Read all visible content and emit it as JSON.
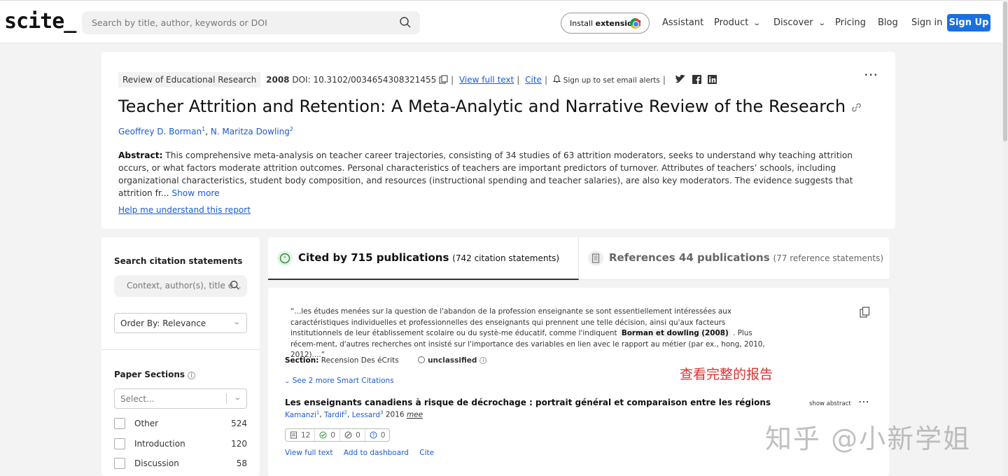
{
  "header": {
    "logo": "scite_",
    "search_placeholder": "Search by title, author, keywords or DOI",
    "extension_prefix": "Install ",
    "extension_bold": "extension!",
    "nav": [
      {
        "label": "Assistant",
        "dropdown": false
      },
      {
        "label": "Product",
        "dropdown": true
      },
      {
        "label": "Discover",
        "dropdown": true
      },
      {
        "label": "Pricing",
        "dropdown": false
      },
      {
        "label": "Blog",
        "dropdown": false
      },
      {
        "label": "Sign in",
        "dropdown": false
      }
    ],
    "signup": "Sign Up"
  },
  "paper": {
    "journal": "Review of Educational Research",
    "year": "2008",
    "doi": "DOI: 10.3102/0034654308321455",
    "view_full_text": "View full text",
    "cite": "Cite",
    "alerts": "Sign up to set email alerts",
    "title": "Teacher Attrition and Retention: A Meta-Analytic and Narrative Review of the Research",
    "authors": [
      {
        "name": "Geoffrey D. Borman",
        "sup": "1"
      },
      {
        "name": "N. Maritza Dowling",
        "sup": "2"
      }
    ],
    "abstract_label": "Abstract:",
    "abstract_text": "This comprehensive meta-analysis on teacher career trajectories, consisting of 34 studies of 63 attrition moderators, seeks to understand why teaching attrition occurs, or what factors moderate attrition outcomes. Personal characteristics of teachers are important predictors of turnover. Attributes of teachers’ schools, including organizational characteristics, student body composition, and resources (instructional spending and teacher salaries), are also key moderators. The evidence suggests that attrition fr...",
    "show_more": "Show more",
    "help_link": "Help me understand this report"
  },
  "sidebar": {
    "search_title": "Search citation statements",
    "search_placeholder": "Context, author(s), title e...",
    "order_by": "Order By: Relevance",
    "sections_title": "Paper Sections",
    "sections_placeholder": "Select...",
    "sections": [
      {
        "label": "Other",
        "count": "524"
      },
      {
        "label": "Introduction",
        "count": "120"
      },
      {
        "label": "Discussion",
        "count": "58"
      }
    ]
  },
  "tabs": {
    "cited_bold": "Cited by 715 publications",
    "cited_small": "(742 citation statements)",
    "refs_bold": "References 44 publications",
    "refs_small": "(77 reference statements)"
  },
  "result": {
    "quote_pre": "“...les études menées sur la question de l'abandon de la profession enseignante se sont essentiellement intéressées aux caractéristiques individuelles et professionnelles des enseignants qui prennent une telle décision, ainsi qu'aux facteurs institutionnels de leur établissement scolaire ou du systè-me éducatif, comme l'indiquent ",
    "quote_cite": "Borman et dowling (2008)",
    "quote_post": " . Plus récem-ment, d'autres recherches ont insisté sur l'importance des variables en lien avec le rapport au métier (par ex., hong, 2010, 2012)....”",
    "section_label": "Section:",
    "section_value": "Recension Des éCrits",
    "classification": "unclassified",
    "see_more": "See 2 more Smart Citations",
    "title": "Les enseignants canadiens à risque de décrochage : portrait général et comparaison entre les régions",
    "authors": [
      {
        "name": "Kamanzi",
        "sup": "1"
      },
      {
        "name": "Tardif",
        "sup": "2"
      },
      {
        "name": "Lessard",
        "sup": "3"
      }
    ],
    "year": "2016",
    "venue": "mee",
    "show_abstract": "show abstract",
    "tally": {
      "total": "12",
      "supporting": "0",
      "mentioning": "0",
      "contrasting": "0"
    },
    "actions": [
      "View full text",
      "Add to dashboard",
      "Cite"
    ]
  },
  "overlay": {
    "red_note": "查看完整的报告",
    "watermark": "知乎 @小新学姐"
  },
  "colors": {
    "accent": "#1a6fe0",
    "link": "#1a5bd6",
    "note": "#e03131"
  }
}
